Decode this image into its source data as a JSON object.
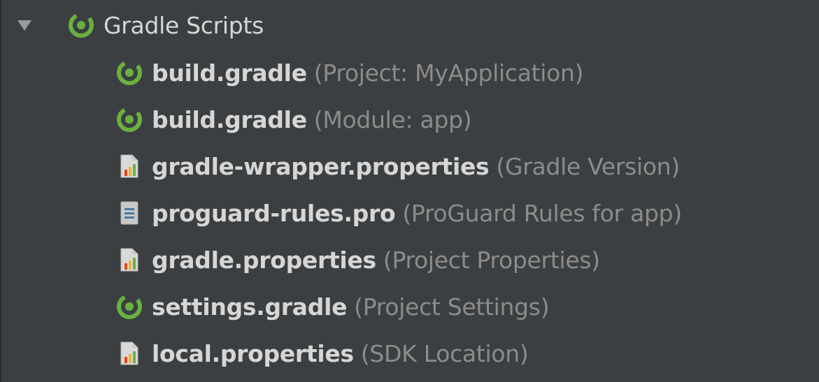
{
  "tree": {
    "root": {
      "label": "Gradle Scripts",
      "icon": "gradle-icon",
      "expanded": true
    },
    "items": [
      {
        "name": "build.gradle",
        "desc": "(Project: MyApplication)",
        "icon": "gradle-icon"
      },
      {
        "name": "build.gradle",
        "desc": "(Module: app)",
        "icon": "gradle-icon"
      },
      {
        "name": "gradle-wrapper.properties",
        "desc": "(Gradle Version)",
        "icon": "properties-file-icon"
      },
      {
        "name": "proguard-rules.pro",
        "desc": "(ProGuard Rules for app)",
        "icon": "text-file-icon"
      },
      {
        "name": "gradle.properties",
        "desc": "(Project Properties)",
        "icon": "properties-file-icon"
      },
      {
        "name": "settings.gradle",
        "desc": "(Project Settings)",
        "icon": "gradle-icon"
      },
      {
        "name": "local.properties",
        "desc": "(SDK Location)",
        "icon": "properties-file-icon"
      }
    ]
  },
  "colors": {
    "background": "#3c3f41",
    "text": "#d6d6d6",
    "muted_text": "#8c8c8c",
    "gradle_green": "#6ab23f",
    "arrow_gray": "#9a9a9a"
  }
}
